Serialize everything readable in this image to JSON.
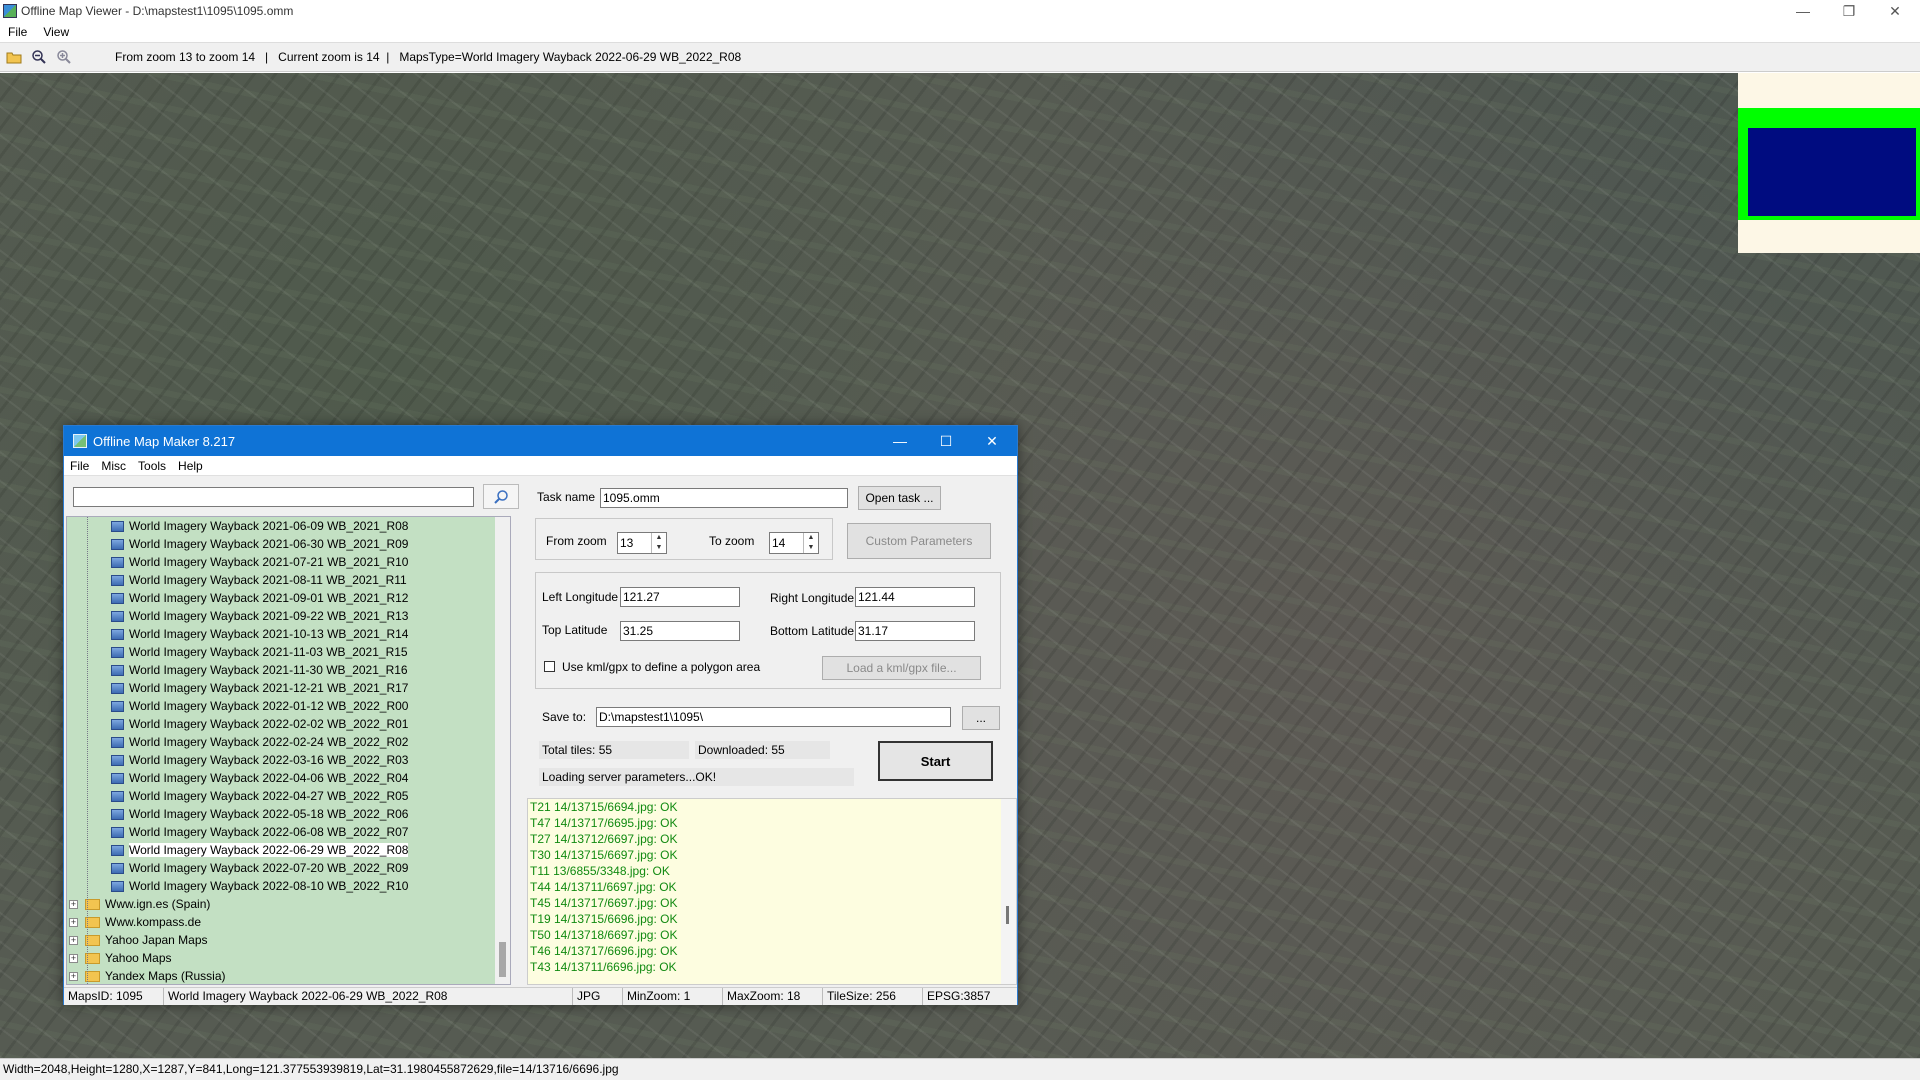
{
  "app": {
    "title": "Offline Map Viewer - D:\\mapstest1\\1095\\1095.omm",
    "menu": [
      "File",
      "View"
    ],
    "toolbar_status": "From zoom 13 to zoom 14   |   Current zoom is 14  |   MapsType=World Imagery Wayback 2022-06-29 WB_2022_R08",
    "status_bar": "Width=2048,Height=1280,X=1287,Y=841,Long=121.377553939819,Lat=31.1980455872629,file=14/13716/6696.jpg",
    "window_controls": {
      "minimize": "—",
      "restore": "❐",
      "close": "✕"
    },
    "colors": {
      "minimap_bg": "#fdf7e6",
      "minimap_frame": "#00ff00",
      "minimap_view": "#000c80"
    }
  },
  "dialog": {
    "title": "Offline Map Maker 8.217",
    "menu": [
      "File",
      "Misc",
      "Tools",
      "Help"
    ],
    "search": {
      "value": "",
      "placeholder": ""
    },
    "tree_children": [
      {
        "label": "World Imagery Wayback 2021-06-09 WB_2021_R08"
      },
      {
        "label": "World Imagery Wayback 2021-06-30 WB_2021_R09"
      },
      {
        "label": "World Imagery Wayback 2021-07-21 WB_2021_R10"
      },
      {
        "label": "World Imagery Wayback 2021-08-11 WB_2021_R11"
      },
      {
        "label": "World Imagery Wayback 2021-09-01 WB_2021_R12"
      },
      {
        "label": "World Imagery Wayback 2021-09-22 WB_2021_R13"
      },
      {
        "label": "World Imagery Wayback 2021-10-13 WB_2021_R14"
      },
      {
        "label": "World Imagery Wayback 2021-11-03 WB_2021_R15"
      },
      {
        "label": "World Imagery Wayback 2021-11-30 WB_2021_R16"
      },
      {
        "label": "World Imagery Wayback 2021-12-21 WB_2021_R17"
      },
      {
        "label": "World Imagery Wayback 2022-01-12 WB_2022_R00"
      },
      {
        "label": "World Imagery Wayback 2022-02-02 WB_2022_R01"
      },
      {
        "label": "World Imagery Wayback 2022-02-24 WB_2022_R02"
      },
      {
        "label": "World Imagery Wayback 2022-03-16 WB_2022_R03"
      },
      {
        "label": "World Imagery Wayback 2022-04-06 WB_2022_R04"
      },
      {
        "label": "World Imagery Wayback 2022-04-27 WB_2022_R05"
      },
      {
        "label": "World Imagery Wayback 2022-05-18 WB_2022_R06"
      },
      {
        "label": "World Imagery Wayback 2022-06-08 WB_2022_R07"
      },
      {
        "label": "World Imagery Wayback 2022-06-29 WB_2022_R08",
        "selected": true
      },
      {
        "label": "World Imagery Wayback 2022-07-20 WB_2022_R09"
      },
      {
        "label": "World Imagery Wayback 2022-08-10 WB_2022_R10"
      }
    ],
    "tree_folders": [
      {
        "label": "Www.ign.es (Spain)"
      },
      {
        "label": "Www.kompass.de"
      },
      {
        "label": "Yahoo Japan Maps"
      },
      {
        "label": "Yahoo Maps"
      },
      {
        "label": "Yandex Maps (Russia)"
      }
    ],
    "task": {
      "label": "Task name",
      "value": "1095.omm",
      "open_button": "Open task ..."
    },
    "zoom": {
      "from_label": "From zoom",
      "from_value": "13",
      "to_label": "To zoom",
      "to_value": "14",
      "custom_button": "Custom Parameters"
    },
    "bounds": {
      "left_label": "Left Longitude",
      "left_value": "121.27",
      "right_label": "Right Longitude",
      "right_value": "121.44",
      "top_label": "Top Latitude",
      "top_value": "31.25",
      "bottom_label": "Bottom Latitude",
      "bottom_value": "31.17",
      "kml_checkbox_label": "Use kml/gpx to define a polygon area",
      "kml_checked": false,
      "kml_button": "Load a kml/gpx file..."
    },
    "save": {
      "label": "Save to:",
      "value": "D:\\mapstest1\\1095\\",
      "browse_button": "..."
    },
    "stats": {
      "total_tiles": "Total tiles: 55",
      "downloaded": "Downloaded: 55",
      "loading": "Loading server parameters...OK!"
    },
    "start_button": "Start",
    "log": [
      "T21 14/13715/6694.jpg: OK",
      "T47 14/13717/6695.jpg: OK",
      "T27 14/13712/6697.jpg: OK",
      "T30 14/13715/6697.jpg: OK",
      "T11 13/6855/3348.jpg: OK",
      "T44 14/13711/6697.jpg: OK",
      "T45 14/13717/6697.jpg: OK",
      "T19 14/13715/6696.jpg: OK",
      "T50 14/13718/6697.jpg: OK",
      "T46 14/13717/6696.jpg: OK",
      "T43 14/13711/6696.jpg: OK"
    ],
    "status": {
      "maps_id": "MapsID: 1095",
      "map_name": "World Imagery Wayback 2022-06-29 WB_2022_R08",
      "format": "JPG",
      "min_zoom": "MinZoom: 1",
      "max_zoom": "MaxZoom: 18",
      "tile_size": "TileSize: 256",
      "epsg": "EPSG:3857"
    }
  }
}
